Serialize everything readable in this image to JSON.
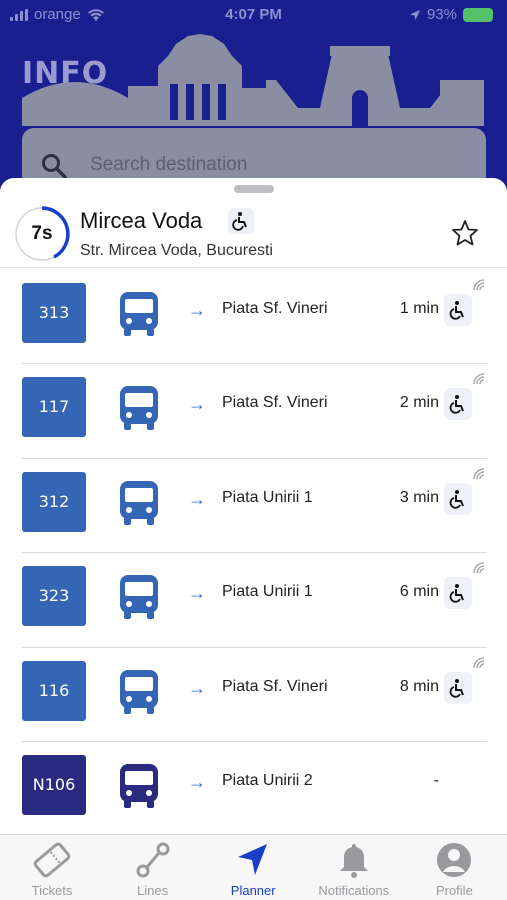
{
  "status_bar": {
    "carrier": "orange",
    "time": "4:07 PM",
    "battery": "93%"
  },
  "header": {
    "logo_text": "INFO",
    "search_placeholder": "Search destination"
  },
  "stop": {
    "countdown": "7s",
    "name": "Mircea Voda",
    "address": "Str. Mircea Voda, Bucuresti"
  },
  "departures": [
    {
      "line": "313",
      "destination": "Piata Sf. Vineri",
      "eta": "1 min",
      "color": "#3466b5",
      "accessible": true
    },
    {
      "line": "117",
      "destination": "Piata Sf. Vineri",
      "eta": "2 min",
      "color": "#3466b5",
      "accessible": true
    },
    {
      "line": "312",
      "destination": "Piata Unirii 1",
      "eta": "3 min",
      "color": "#3466b5",
      "accessible": true
    },
    {
      "line": "323",
      "destination": "Piata Unirii 1",
      "eta": "6 min",
      "color": "#3466b5",
      "accessible": true
    },
    {
      "line": "116",
      "destination": "Piata Sf. Vineri",
      "eta": "8 min",
      "color": "#3466b5",
      "accessible": true
    },
    {
      "line": "N106",
      "destination": "Piata Unirii 2",
      "eta": "-",
      "color": "#2a2a80",
      "accessible": false
    }
  ],
  "tabs": [
    {
      "label": "Tickets",
      "icon": "ticket-icon",
      "active": false
    },
    {
      "label": "Lines",
      "icon": "route-icon",
      "active": false
    },
    {
      "label": "Planner",
      "icon": "navigation-arrow-icon",
      "active": true
    },
    {
      "label": "Notifications",
      "icon": "bell-icon",
      "active": false
    },
    {
      "label": "Profile",
      "icon": "person-icon",
      "active": false
    }
  ],
  "colors": {
    "header_bg": "#1a1f8f",
    "accent": "#1a3ec9",
    "bus_blue": "#3466b5",
    "night_bus": "#2a2a80"
  }
}
